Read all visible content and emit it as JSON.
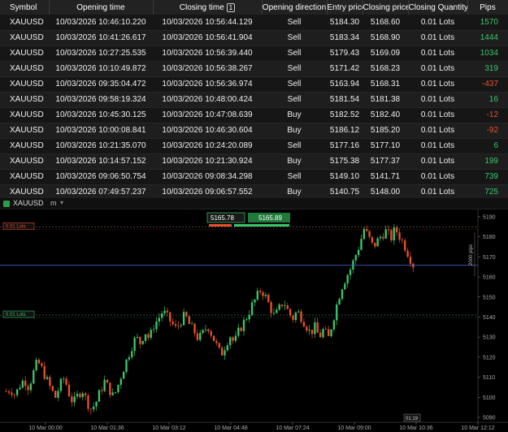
{
  "table": {
    "columns": [
      "Symbol",
      "Opening time",
      "Closing time",
      "Opening direction",
      "Entry price",
      "Closing price",
      "Closing Quantity",
      "Pips"
    ],
    "sort_badge": "1",
    "rows": [
      {
        "symbol": "XAUUSD",
        "open": "10/03/2026 10:46:10.220",
        "close": "10/03/2026 10:56:44.129",
        "dir": "Sell",
        "entry": "5184.30",
        "closep": "5168.60",
        "qty": "0.01 Lots",
        "pips": "1570"
      },
      {
        "symbol": "XAUUSD",
        "open": "10/03/2026 10:41:26.617",
        "close": "10/03/2026 10:56:41.904",
        "dir": "Sell",
        "entry": "5183.34",
        "closep": "5168.90",
        "qty": "0.01 Lots",
        "pips": "1444"
      },
      {
        "symbol": "XAUUSD",
        "open": "10/03/2026 10:27:25.535",
        "close": "10/03/2026 10:56:39.440",
        "dir": "Sell",
        "entry": "5179.43",
        "closep": "5169.09",
        "qty": "0.01 Lots",
        "pips": "1034"
      },
      {
        "symbol": "XAUUSD",
        "open": "10/03/2026 10:10:49.872",
        "close": "10/03/2026 10:56:38.267",
        "dir": "Sell",
        "entry": "5171.42",
        "closep": "5168.23",
        "qty": "0.01 Lots",
        "pips": "319"
      },
      {
        "symbol": "XAUUSD",
        "open": "10/03/2026 09:35:04.472",
        "close": "10/03/2026 10:56:36.974",
        "dir": "Sell",
        "entry": "5163.94",
        "closep": "5168.31",
        "qty": "0.01 Lots",
        "pips": "-437"
      },
      {
        "symbol": "XAUUSD",
        "open": "10/03/2026 09:58:19.324",
        "close": "10/03/2026 10:48:00.424",
        "dir": "Sell",
        "entry": "5181.54",
        "closep": "5181.38",
        "qty": "0.01 Lots",
        "pips": "16"
      },
      {
        "symbol": "XAUUSD",
        "open": "10/03/2026 10:45:30.125",
        "close": "10/03/2026 10:47:08.639",
        "dir": "Buy",
        "entry": "5182.52",
        "closep": "5182.40",
        "qty": "0.01 Lots",
        "pips": "-12"
      },
      {
        "symbol": "XAUUSD",
        "open": "10/03/2026 10:00:08.841",
        "close": "10/03/2026 10:46:30.604",
        "dir": "Buy",
        "entry": "5186.12",
        "closep": "5185.20",
        "qty": "0.01 Lots",
        "pips": "-92"
      },
      {
        "symbol": "XAUUSD",
        "open": "10/03/2026 10:21:35.070",
        "close": "10/03/2026 10:24:20.089",
        "dir": "Sell",
        "entry": "5177.16",
        "closep": "5177.10",
        "qty": "0.01 Lots",
        "pips": "6"
      },
      {
        "symbol": "XAUUSD",
        "open": "10/03/2026 10:14:57.152",
        "close": "10/03/2026 10:21:30.924",
        "dir": "Buy",
        "entry": "5175.38",
        "closep": "5177.37",
        "qty": "0.01 Lots",
        "pips": "199"
      },
      {
        "symbol": "XAUUSD",
        "open": "10/03/2026 09:06:50.754",
        "close": "10/03/2026 09:08:34.298",
        "dir": "Sell",
        "entry": "5149.10",
        "closep": "5141.71",
        "qty": "0.01 Lots",
        "pips": "739"
      },
      {
        "symbol": "XAUUSD",
        "open": "10/03/2026 07:49:57.237",
        "close": "10/03/2026 09:06:57.552",
        "dir": "Buy",
        "entry": "5140.75",
        "closep": "5148.00",
        "qty": "0.01 Lots",
        "pips": "725"
      }
    ]
  },
  "chart_toolbar": {
    "symbol": "XAUUSD",
    "timeframe": "m",
    "sym_icon": "chart-icon",
    "caret": "▾"
  },
  "chart_data": {
    "type": "candlestick",
    "symbol": "XAUUSD",
    "ylim": [
      5090,
      5192
    ],
    "y_ticks": [
      "5190",
      "5180",
      "5170",
      "5160",
      "5150",
      "5140",
      "5130",
      "5120",
      "5110",
      "5100",
      "5090"
    ],
    "x_ticks": [
      "10 Mar 00:00",
      "10 Mar 01:36",
      "10 Mar 03:12",
      "10 Mar 04:48",
      "10 Mar 07:24",
      "10 Mar 09:00",
      "10 Mar 10:36",
      "10 Mar 12:12"
    ],
    "current_price": "5165.78",
    "bid_badge": "5165.78",
    "ask_badge": "5165.89",
    "range_label": "2000 pips",
    "time_label": "01:19",
    "order_lines": [
      {
        "label": "0.01 Lots",
        "price": 5185,
        "color": "#e8502c"
      },
      {
        "label": "0.01 Lots",
        "price": 5141,
        "color": "#3cc46a"
      }
    ],
    "up_color": "#3cc46a",
    "down_color": "#e8502c",
    "price_path": [
      5103,
      5104,
      5101,
      5106,
      5109,
      5105,
      5112,
      5118,
      5114,
      5109,
      5104,
      5100,
      5106,
      5110,
      5102,
      5097,
      5101,
      5104,
      5098,
      5094,
      5097,
      5103,
      5108,
      5104,
      5100,
      5106,
      5113,
      5119,
      5125,
      5130,
      5127,
      5133,
      5129,
      5136,
      5139,
      5143,
      5140,
      5137,
      5134,
      5138,
      5141,
      5136,
      5133,
      5129,
      5132,
      5136,
      5131,
      5126,
      5121,
      5126,
      5131,
      5127,
      5133,
      5137,
      5141,
      5146,
      5150,
      5154,
      5150,
      5145,
      5140,
      5144,
      5148,
      5143,
      5139,
      5143,
      5140,
      5136,
      5132,
      5135,
      5130,
      5134,
      5129,
      5138,
      5147,
      5155,
      5160,
      5164,
      5170,
      5176,
      5184,
      5180,
      5175,
      5178,
      5181,
      5183,
      5179,
      5184,
      5180,
      5176,
      5171,
      5166
    ]
  }
}
